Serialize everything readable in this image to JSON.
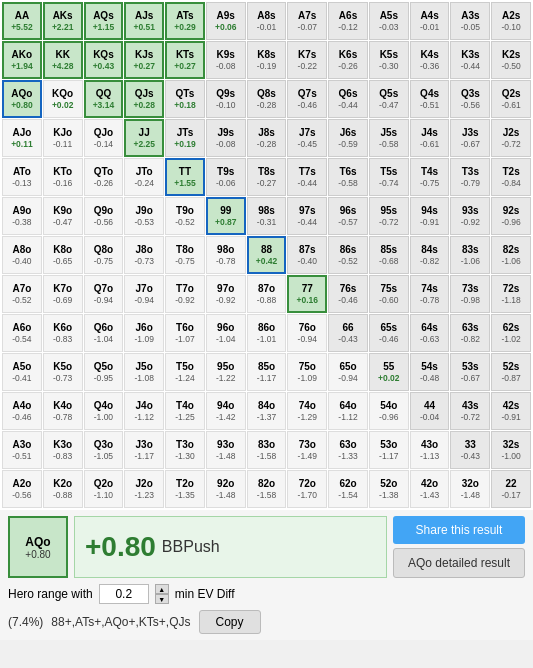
{
  "grid": {
    "cells": [
      {
        "hand": "AA",
        "ev": "+5.52",
        "type": "pair",
        "highlight": true
      },
      {
        "hand": "AKs",
        "ev": "+2.21",
        "type": "suited",
        "highlight": true
      },
      {
        "hand": "AQs",
        "ev": "+1.15",
        "type": "suited",
        "highlight": true
      },
      {
        "hand": "AJs",
        "ev": "+0.51",
        "type": "suited",
        "highlight": true
      },
      {
        "hand": "ATs",
        "ev": "+0.29",
        "type": "suited",
        "highlight": true
      },
      {
        "hand": "A9s",
        "ev": "+0.06",
        "type": "suited"
      },
      {
        "hand": "A8s",
        "ev": "-0.01",
        "type": "suited"
      },
      {
        "hand": "A7s",
        "ev": "-0.07",
        "type": "suited"
      },
      {
        "hand": "A6s",
        "ev": "-0.12",
        "type": "suited"
      },
      {
        "hand": "A5s",
        "ev": "-0.03",
        "type": "suited"
      },
      {
        "hand": "A4s",
        "ev": "-0.01",
        "type": "suited"
      },
      {
        "hand": "A3s",
        "ev": "-0.05",
        "type": "suited"
      },
      {
        "hand": "A2s",
        "ev": "-0.10",
        "type": "suited"
      },
      {
        "hand": "AKo",
        "ev": "+1.94",
        "type": "offsuit",
        "highlight": true
      },
      {
        "hand": "KK",
        "ev": "+4.28",
        "type": "pair",
        "highlight": true
      },
      {
        "hand": "KQs",
        "ev": "+0.43",
        "type": "suited",
        "highlight": true
      },
      {
        "hand": "KJs",
        "ev": "+0.27",
        "type": "suited",
        "highlight": true
      },
      {
        "hand": "KTs",
        "ev": "+0.27",
        "type": "suited",
        "highlight": true
      },
      {
        "hand": "K9s",
        "ev": "-0.08",
        "type": "suited"
      },
      {
        "hand": "K8s",
        "ev": "-0.19",
        "type": "suited"
      },
      {
        "hand": "K7s",
        "ev": "-0.22",
        "type": "suited"
      },
      {
        "hand": "K6s",
        "ev": "-0.26",
        "type": "suited"
      },
      {
        "hand": "K5s",
        "ev": "-0.30",
        "type": "suited"
      },
      {
        "hand": "K4s",
        "ev": "-0.36",
        "type": "suited"
      },
      {
        "hand": "K3s",
        "ev": "-0.44",
        "type": "suited"
      },
      {
        "hand": "K2s",
        "ev": "-0.50",
        "type": "suited"
      },
      {
        "hand": "AQo",
        "ev": "+0.80",
        "type": "offsuit",
        "highlight": true,
        "blue": true
      },
      {
        "hand": "KQo",
        "ev": "+0.02",
        "type": "offsuit"
      },
      {
        "hand": "QQ",
        "ev": "+3.14",
        "type": "pair",
        "highlight": true
      },
      {
        "hand": "QJs",
        "ev": "+0.28",
        "type": "suited",
        "highlight": true
      },
      {
        "hand": "QTs",
        "ev": "+0.18",
        "type": "suited"
      },
      {
        "hand": "Q9s",
        "ev": "-0.10",
        "type": "suited"
      },
      {
        "hand": "Q8s",
        "ev": "-0.28",
        "type": "suited"
      },
      {
        "hand": "Q7s",
        "ev": "-0.46",
        "type": "suited"
      },
      {
        "hand": "Q6s",
        "ev": "-0.44",
        "type": "suited"
      },
      {
        "hand": "Q5s",
        "ev": "-0.47",
        "type": "suited"
      },
      {
        "hand": "Q4s",
        "ev": "-0.51",
        "type": "suited"
      },
      {
        "hand": "Q3s",
        "ev": "-0.56",
        "type": "suited"
      },
      {
        "hand": "Q2s",
        "ev": "-0.61",
        "type": "suited"
      },
      {
        "hand": "AJo",
        "ev": "+0.11",
        "type": "offsuit"
      },
      {
        "hand": "KJo",
        "ev": "-0.11",
        "type": "offsuit"
      },
      {
        "hand": "QJo",
        "ev": "-0.14",
        "type": "offsuit"
      },
      {
        "hand": "JJ",
        "ev": "+2.25",
        "type": "pair",
        "highlight": true
      },
      {
        "hand": "JTs",
        "ev": "+0.19",
        "type": "suited"
      },
      {
        "hand": "J9s",
        "ev": "-0.08",
        "type": "suited"
      },
      {
        "hand": "J8s",
        "ev": "-0.28",
        "type": "suited"
      },
      {
        "hand": "J7s",
        "ev": "-0.45",
        "type": "suited"
      },
      {
        "hand": "J6s",
        "ev": "-0.59",
        "type": "suited"
      },
      {
        "hand": "J5s",
        "ev": "-0.58",
        "type": "suited"
      },
      {
        "hand": "J4s",
        "ev": "-0.61",
        "type": "suited"
      },
      {
        "hand": "J3s",
        "ev": "-0.67",
        "type": "suited"
      },
      {
        "hand": "J2s",
        "ev": "-0.72",
        "type": "suited"
      },
      {
        "hand": "ATo",
        "ev": "-0.13",
        "type": "offsuit"
      },
      {
        "hand": "KTo",
        "ev": "-0.16",
        "type": "offsuit"
      },
      {
        "hand": "QTo",
        "ev": "-0.26",
        "type": "offsuit"
      },
      {
        "hand": "JTo",
        "ev": "-0.24",
        "type": "offsuit"
      },
      {
        "hand": "TT",
        "ev": "+1.55",
        "type": "pair",
        "highlight": true,
        "blue": true
      },
      {
        "hand": "T9s",
        "ev": "-0.06",
        "type": "suited"
      },
      {
        "hand": "T8s",
        "ev": "-0.27",
        "type": "suited"
      },
      {
        "hand": "T7s",
        "ev": "-0.44",
        "type": "suited"
      },
      {
        "hand": "T6s",
        "ev": "-0.58",
        "type": "suited"
      },
      {
        "hand": "T5s",
        "ev": "-0.74",
        "type": "suited"
      },
      {
        "hand": "T4s",
        "ev": "-0.75",
        "type": "suited"
      },
      {
        "hand": "T3s",
        "ev": "-0.79",
        "type": "suited"
      },
      {
        "hand": "T2s",
        "ev": "-0.84",
        "type": "suited"
      },
      {
        "hand": "A9o",
        "ev": "-0.38",
        "type": "offsuit"
      },
      {
        "hand": "K9o",
        "ev": "-0.47",
        "type": "offsuit"
      },
      {
        "hand": "Q9o",
        "ev": "-0.56",
        "type": "offsuit"
      },
      {
        "hand": "J9o",
        "ev": "-0.53",
        "type": "offsuit"
      },
      {
        "hand": "T9o",
        "ev": "-0.52",
        "type": "offsuit"
      },
      {
        "hand": "99",
        "ev": "+0.87",
        "type": "pair",
        "highlight": true,
        "blue": true
      },
      {
        "hand": "98s",
        "ev": "-0.31",
        "type": "suited"
      },
      {
        "hand": "97s",
        "ev": "-0.44",
        "type": "suited"
      },
      {
        "hand": "96s",
        "ev": "-0.57",
        "type": "suited"
      },
      {
        "hand": "95s",
        "ev": "-0.72",
        "type": "suited"
      },
      {
        "hand": "94s",
        "ev": "-0.91",
        "type": "suited"
      },
      {
        "hand": "93s",
        "ev": "-0.92",
        "type": "suited"
      },
      {
        "hand": "92s",
        "ev": "-0.96",
        "type": "suited"
      },
      {
        "hand": "A8o",
        "ev": "-0.40",
        "type": "offsuit"
      },
      {
        "hand": "K8o",
        "ev": "-0.65",
        "type": "offsuit"
      },
      {
        "hand": "Q8o",
        "ev": "-0.75",
        "type": "offsuit"
      },
      {
        "hand": "J8o",
        "ev": "-0.73",
        "type": "offsuit"
      },
      {
        "hand": "T8o",
        "ev": "-0.75",
        "type": "offsuit"
      },
      {
        "hand": "98o",
        "ev": "-0.78",
        "type": "offsuit"
      },
      {
        "hand": "88",
        "ev": "+0.42",
        "type": "pair",
        "highlight": true,
        "blue": true
      },
      {
        "hand": "87s",
        "ev": "-0.40",
        "type": "suited"
      },
      {
        "hand": "86s",
        "ev": "-0.52",
        "type": "suited"
      },
      {
        "hand": "85s",
        "ev": "-0.68",
        "type": "suited"
      },
      {
        "hand": "84s",
        "ev": "-0.82",
        "type": "suited"
      },
      {
        "hand": "83s",
        "ev": "-1.06",
        "type": "suited"
      },
      {
        "hand": "82s",
        "ev": "-1.06",
        "type": "suited"
      },
      {
        "hand": "A7o",
        "ev": "-0.52",
        "type": "offsuit"
      },
      {
        "hand": "K7o",
        "ev": "-0.69",
        "type": "offsuit"
      },
      {
        "hand": "Q7o",
        "ev": "-0.94",
        "type": "offsuit"
      },
      {
        "hand": "J7o",
        "ev": "-0.94",
        "type": "offsuit"
      },
      {
        "hand": "T7o",
        "ev": "-0.92",
        "type": "offsuit"
      },
      {
        "hand": "97o",
        "ev": "-0.92",
        "type": "offsuit"
      },
      {
        "hand": "87o",
        "ev": "-0.88",
        "type": "offsuit"
      },
      {
        "hand": "77",
        "ev": "+0.16",
        "type": "pair",
        "highlight": true
      },
      {
        "hand": "76s",
        "ev": "-0.46",
        "type": "suited"
      },
      {
        "hand": "75s",
        "ev": "-0.60",
        "type": "suited"
      },
      {
        "hand": "74s",
        "ev": "-0.78",
        "type": "suited"
      },
      {
        "hand": "73s",
        "ev": "-0.98",
        "type": "suited"
      },
      {
        "hand": "72s",
        "ev": "-1.18",
        "type": "suited"
      },
      {
        "hand": "A6o",
        "ev": "-0.54",
        "type": "offsuit"
      },
      {
        "hand": "K6o",
        "ev": "-0.83",
        "type": "offsuit"
      },
      {
        "hand": "Q6o",
        "ev": "-1.04",
        "type": "offsuit"
      },
      {
        "hand": "J6o",
        "ev": "-1.09",
        "type": "offsuit"
      },
      {
        "hand": "T6o",
        "ev": "-1.07",
        "type": "offsuit"
      },
      {
        "hand": "96o",
        "ev": "-1.04",
        "type": "offsuit"
      },
      {
        "hand": "86o",
        "ev": "-1.01",
        "type": "offsuit"
      },
      {
        "hand": "76o",
        "ev": "-0.94",
        "type": "offsuit"
      },
      {
        "hand": "66",
        "ev": "-0.43",
        "type": "pair"
      },
      {
        "hand": "65s",
        "ev": "-0.46",
        "type": "suited"
      },
      {
        "hand": "64s",
        "ev": "-0.63",
        "type": "suited"
      },
      {
        "hand": "63s",
        "ev": "-0.82",
        "type": "suited"
      },
      {
        "hand": "62s",
        "ev": "-1.02",
        "type": "suited"
      },
      {
        "hand": "A5o",
        "ev": "-0.41",
        "type": "offsuit"
      },
      {
        "hand": "K5o",
        "ev": "-0.73",
        "type": "offsuit"
      },
      {
        "hand": "Q5o",
        "ev": "-0.95",
        "type": "offsuit"
      },
      {
        "hand": "J5o",
        "ev": "-1.08",
        "type": "offsuit"
      },
      {
        "hand": "T5o",
        "ev": "-1.24",
        "type": "offsuit"
      },
      {
        "hand": "95o",
        "ev": "-1.22",
        "type": "offsuit"
      },
      {
        "hand": "85o",
        "ev": "-1.17",
        "type": "offsuit"
      },
      {
        "hand": "75o",
        "ev": "-1.09",
        "type": "offsuit"
      },
      {
        "hand": "65o",
        "ev": "-0.94",
        "type": "offsuit"
      },
      {
        "hand": "55",
        "ev": "+0.02",
        "type": "pair"
      },
      {
        "hand": "54s",
        "ev": "-0.48",
        "type": "suited"
      },
      {
        "hand": "53s",
        "ev": "-0.67",
        "type": "suited"
      },
      {
        "hand": "52s",
        "ev": "-0.87",
        "type": "suited"
      },
      {
        "hand": "A4o",
        "ev": "-0.46",
        "type": "offsuit"
      },
      {
        "hand": "K4o",
        "ev": "-0.78",
        "type": "offsuit"
      },
      {
        "hand": "Q4o",
        "ev": "-1.00",
        "type": "offsuit"
      },
      {
        "hand": "J4o",
        "ev": "-1.12",
        "type": "offsuit"
      },
      {
        "hand": "T4o",
        "ev": "-1.25",
        "type": "offsuit"
      },
      {
        "hand": "94o",
        "ev": "-1.42",
        "type": "offsuit"
      },
      {
        "hand": "84o",
        "ev": "-1.37",
        "type": "offsuit"
      },
      {
        "hand": "74o",
        "ev": "-1.29",
        "type": "offsuit"
      },
      {
        "hand": "64o",
        "ev": "-1.12",
        "type": "offsuit"
      },
      {
        "hand": "54o",
        "ev": "-0.96",
        "type": "offsuit"
      },
      {
        "hand": "44",
        "ev": "-0.04",
        "type": "pair"
      },
      {
        "hand": "43s",
        "ev": "-0.72",
        "type": "suited"
      },
      {
        "hand": "42s",
        "ev": "-0.91",
        "type": "suited"
      },
      {
        "hand": "A3o",
        "ev": "-0.51",
        "type": "offsuit"
      },
      {
        "hand": "K3o",
        "ev": "-0.83",
        "type": "offsuit"
      },
      {
        "hand": "Q3o",
        "ev": "-1.05",
        "type": "offsuit"
      },
      {
        "hand": "J3o",
        "ev": "-1.17",
        "type": "offsuit"
      },
      {
        "hand": "T3o",
        "ev": "-1.30",
        "type": "offsuit"
      },
      {
        "hand": "93o",
        "ev": "-1.48",
        "type": "offsuit"
      },
      {
        "hand": "83o",
        "ev": "-1.58",
        "type": "offsuit"
      },
      {
        "hand": "73o",
        "ev": "-1.49",
        "type": "offsuit"
      },
      {
        "hand": "63o",
        "ev": "-1.33",
        "type": "offsuit"
      },
      {
        "hand": "53o",
        "ev": "-1.17",
        "type": "offsuit"
      },
      {
        "hand": "43o",
        "ev": "-1.13",
        "type": "offsuit"
      },
      {
        "hand": "33",
        "ev": "-0.43",
        "type": "pair"
      },
      {
        "hand": "32s",
        "ev": "-1.00",
        "type": "suited"
      },
      {
        "hand": "A2o",
        "ev": "-0.56",
        "type": "offsuit"
      },
      {
        "hand": "K2o",
        "ev": "-0.88",
        "type": "offsuit"
      },
      {
        "hand": "Q2o",
        "ev": "-1.10",
        "type": "offsuit"
      },
      {
        "hand": "J2o",
        "ev": "-1.23",
        "type": "offsuit"
      },
      {
        "hand": "T2o",
        "ev": "-1.35",
        "type": "offsuit"
      },
      {
        "hand": "92o",
        "ev": "-1.48",
        "type": "offsuit"
      },
      {
        "hand": "82o",
        "ev": "-1.58",
        "type": "offsuit"
      },
      {
        "hand": "72o",
        "ev": "-1.70",
        "type": "offsuit"
      },
      {
        "hand": "62o",
        "ev": "-1.54",
        "type": "offsuit"
      },
      {
        "hand": "52o",
        "ev": "-1.38",
        "type": "offsuit"
      },
      {
        "hand": "42o",
        "ev": "-1.43",
        "type": "offsuit"
      },
      {
        "hand": "32o",
        "ev": "-1.48",
        "type": "offsuit"
      },
      {
        "hand": "22",
        "ev": "-0.17",
        "type": "pair"
      }
    ]
  },
  "result": {
    "hand": "AQo",
    "ev": "+0.80",
    "value_text": "+0.80",
    "bb_label": "BBPush",
    "share_button": "Share this result",
    "detail_button": "AQo detailed result"
  },
  "filter": {
    "label": "Hero range with",
    "value": "0.2",
    "suffix": "min EV Diff"
  },
  "range": {
    "percent_text": "(7.4%)",
    "range_text": "88+,ATs+,AQo+,KTs+,QJs",
    "copy_label": "Copy"
  }
}
